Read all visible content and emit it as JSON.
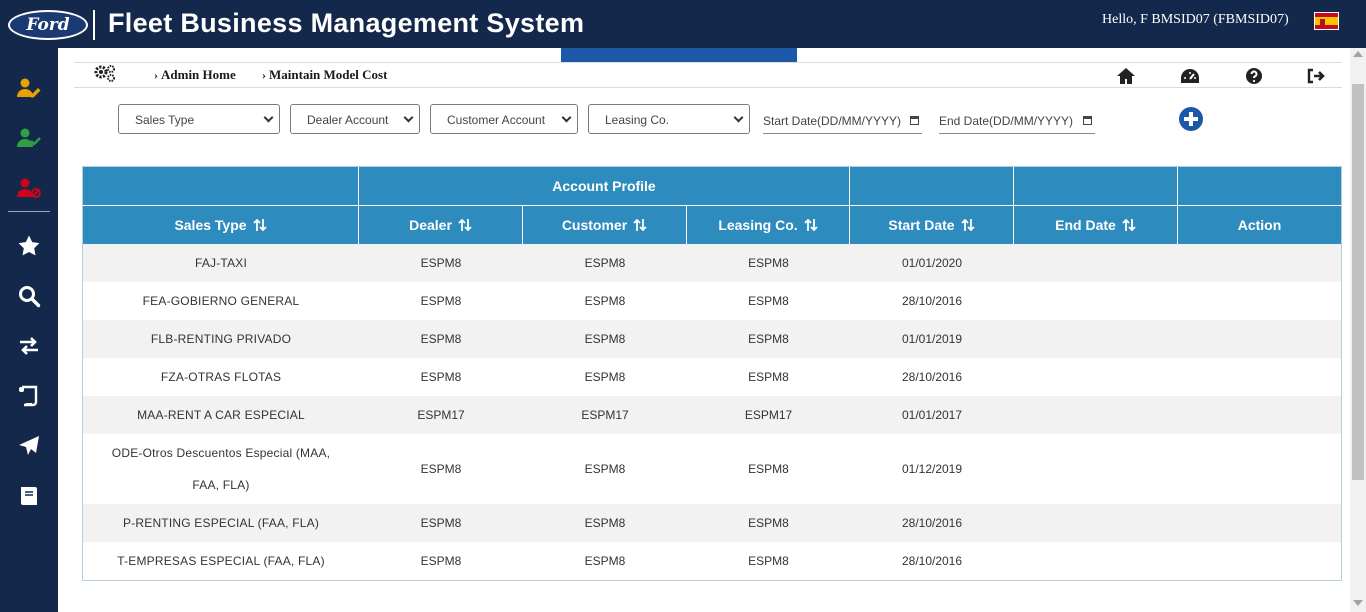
{
  "header": {
    "logo_text": "Ford",
    "app_title": "Fleet Business Management System",
    "greeting": "Hello, F BMSID07 (FBMSID07)",
    "flag": "spain-flag-icon"
  },
  "sidebar": {
    "items": [
      {
        "icon": "user-edit-icon",
        "color": "#e8a100"
      },
      {
        "icon": "user-check-icon",
        "color": "#2ea043"
      },
      {
        "icon": "user-block-icon",
        "color": "#d0021b"
      },
      {
        "icon": "star-icon",
        "color": "#ffffff"
      },
      {
        "icon": "search-icon",
        "color": "#ffffff"
      },
      {
        "icon": "exchange-icon",
        "color": "#ffffff"
      },
      {
        "icon": "scroll-icon",
        "color": "#ffffff"
      },
      {
        "icon": "paper-plane-icon",
        "color": "#ffffff"
      },
      {
        "icon": "book-icon",
        "color": "#ffffff"
      }
    ]
  },
  "breadcrumb": {
    "items": [
      "Admin Home",
      "Maintain Model Cost"
    ]
  },
  "toolbar_icons": [
    "home-icon",
    "dashboard-icon",
    "help-icon",
    "logout-icon"
  ],
  "filters": {
    "sales_type": "Sales Type",
    "dealer_account": "Dealer Account",
    "customer_account": "Customer Account",
    "leasing_co": "Leasing Co.",
    "start_date_placeholder": "Start Date(DD/MM/YYYY)",
    "end_date_placeholder": "End Date(DD/MM/YYYY)"
  },
  "table": {
    "group_header": "Account Profile",
    "columns": [
      "Sales Type",
      "Dealer",
      "Customer",
      "Leasing Co.",
      "Start Date",
      "End Date",
      "Action"
    ],
    "rows": [
      [
        "FAJ-TAXI",
        "ESPM8",
        "ESPM8",
        "ESPM8",
        "01/01/2020",
        "",
        ""
      ],
      [
        "FEA-GOBIERNO GENERAL",
        "ESPM8",
        "ESPM8",
        "ESPM8",
        "28/10/2016",
        "",
        ""
      ],
      [
        "FLB-RENTING PRIVADO",
        "ESPM8",
        "ESPM8",
        "ESPM8",
        "01/01/2019",
        "",
        ""
      ],
      [
        "FZA-OTRAS FLOTAS",
        "ESPM8",
        "ESPM8",
        "ESPM8",
        "28/10/2016",
        "",
        ""
      ],
      [
        "MAA-RENT A CAR ESPECIAL",
        "ESPM17",
        "ESPM17",
        "ESPM17",
        "01/01/2017",
        "",
        ""
      ],
      [
        "ODE-Otros Descuentos Especial (MAA, FAA, FLA)",
        "ESPM8",
        "ESPM8",
        "ESPM8",
        "01/12/2019",
        "",
        ""
      ],
      [
        "P-RENTING ESPECIAL (FAA, FLA)",
        "ESPM8",
        "ESPM8",
        "ESPM8",
        "28/10/2016",
        "",
        ""
      ],
      [
        "T-EMPRESAS ESPECIAL (FAA, FLA)",
        "ESPM8",
        "ESPM8",
        "ESPM8",
        "28/10/2016",
        "",
        ""
      ]
    ]
  },
  "colors": {
    "nav_bg": "#14284b",
    "table_header": "#2e8bbd",
    "accent": "#1b58a8"
  }
}
